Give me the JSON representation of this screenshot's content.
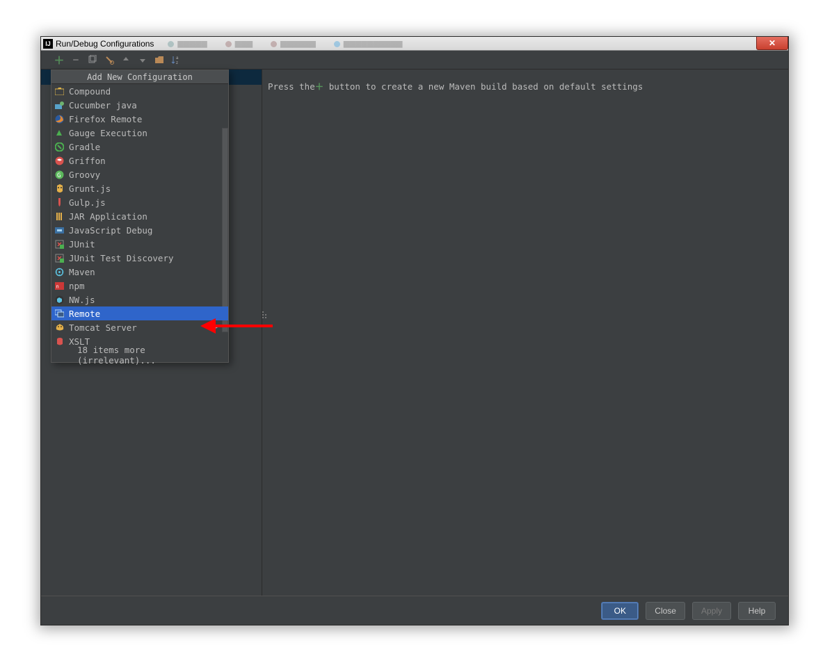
{
  "titlebar": {
    "title": "Run/Debug Configurations",
    "ghost_tabs": [
      "",
      "",
      "",
      ""
    ],
    "close_label": "X"
  },
  "hint": {
    "prefix": "Press the",
    "suffix": "button to create a new Maven build based on default settings"
  },
  "popup": {
    "title": "Add New Configuration",
    "items": [
      {
        "label": "Compound",
        "icon_name": "compound-icon",
        "fg": "#e0b64a",
        "selected": false
      },
      {
        "label": "Cucumber java",
        "icon_name": "cucumber-icon",
        "fg": "#6fb36f",
        "selected": false
      },
      {
        "label": "Firefox Remote",
        "icon_name": "firefox-icon",
        "fg": "#e08836",
        "selected": false
      },
      {
        "label": "Gauge Execution",
        "icon_name": "gauge-icon",
        "fg": "#4caf50",
        "selected": false
      },
      {
        "label": "Gradle",
        "icon_name": "gradle-icon",
        "fg": "#4caf50",
        "selected": false
      },
      {
        "label": "Griffon",
        "icon_name": "griffon-icon",
        "fg": "#d9534f",
        "selected": false
      },
      {
        "label": "Groovy",
        "icon_name": "groovy-icon",
        "fg": "#5cb85c",
        "selected": false
      },
      {
        "label": "Grunt.js",
        "icon_name": "grunt-icon",
        "fg": "#e4b04a",
        "selected": false
      },
      {
        "label": "Gulp.js",
        "icon_name": "gulp-icon",
        "fg": "#d9534f",
        "selected": false
      },
      {
        "label": "JAR Application",
        "icon_name": "jar-icon",
        "fg": "#e4b04a",
        "selected": false
      },
      {
        "label": "JavaScript Debug",
        "icon_name": "js-debug-icon",
        "fg": "#5bc0de",
        "selected": false
      },
      {
        "label": "JUnit",
        "icon_name": "junit-icon",
        "fg": "#d9534f",
        "selected": false
      },
      {
        "label": "JUnit Test Discovery",
        "icon_name": "junit-discover-icon",
        "fg": "#d9534f",
        "selected": false
      },
      {
        "label": "Maven",
        "icon_name": "maven-icon",
        "fg": "#5bc0de",
        "selected": false
      },
      {
        "label": "npm",
        "icon_name": "npm-icon",
        "fg": "#cb3837",
        "selected": false
      },
      {
        "label": "NW.js",
        "icon_name": "nwjs-icon",
        "fg": "#5bc0de",
        "selected": false
      },
      {
        "label": "Remote",
        "icon_name": "remote-icon",
        "fg": "#bfe1ff",
        "selected": true
      },
      {
        "label": "Tomcat Server",
        "icon_name": "tomcat-icon",
        "fg": "#e4b04a",
        "selected": false,
        "has_submenu": true
      },
      {
        "label": "XSLT",
        "icon_name": "xslt-icon",
        "fg": "#d9534f",
        "selected": false
      },
      {
        "label": "18 items more (irrelevant)...",
        "icon_name": "",
        "fg": "",
        "selected": false,
        "indent": true
      }
    ]
  },
  "buttons": {
    "ok": "OK",
    "close": "Close",
    "apply": "Apply",
    "help": "Help"
  }
}
